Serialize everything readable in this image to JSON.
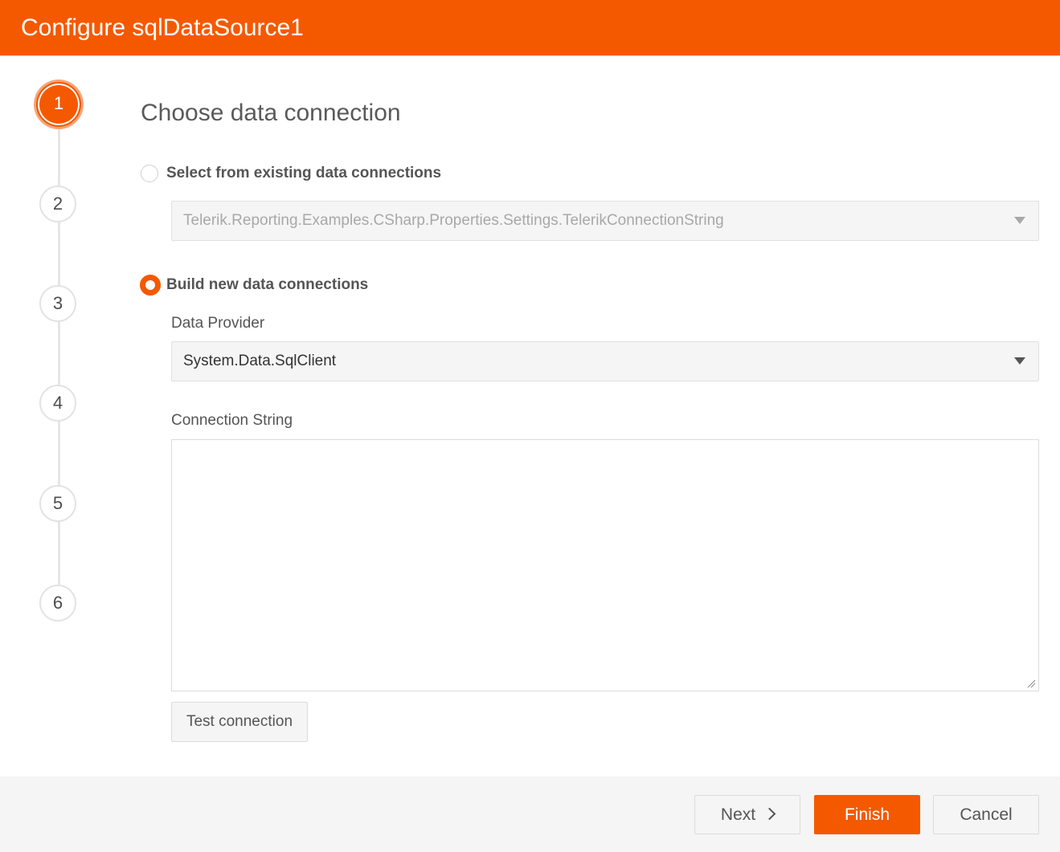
{
  "window": {
    "title": "Configure sqlDataSource1"
  },
  "stepper": {
    "steps": [
      "1",
      "2",
      "3",
      "4",
      "5",
      "6"
    ],
    "active_step": "1"
  },
  "page": {
    "title": "Choose data connection"
  },
  "existing": {
    "label": "Select from existing data connections",
    "selected": false,
    "value": "Telerik.Reporting.Examples.CSharp.Properties.Settings.TelerikConnectionString"
  },
  "build_new": {
    "label": "Build new data connections",
    "selected": true
  },
  "data_provider": {
    "label": "Data Provider",
    "value": "System.Data.SqlClient"
  },
  "connection_string": {
    "label": "Connection String",
    "value": ""
  },
  "buttons": {
    "test_connection": "Test connection",
    "next": "Next",
    "finish": "Finish",
    "cancel": "Cancel"
  },
  "colors": {
    "accent": "#f45900",
    "footer_bg": "#f5f5f5"
  },
  "icons": {
    "dropdown": "caret-down-icon",
    "next": "chevron-right-icon"
  }
}
